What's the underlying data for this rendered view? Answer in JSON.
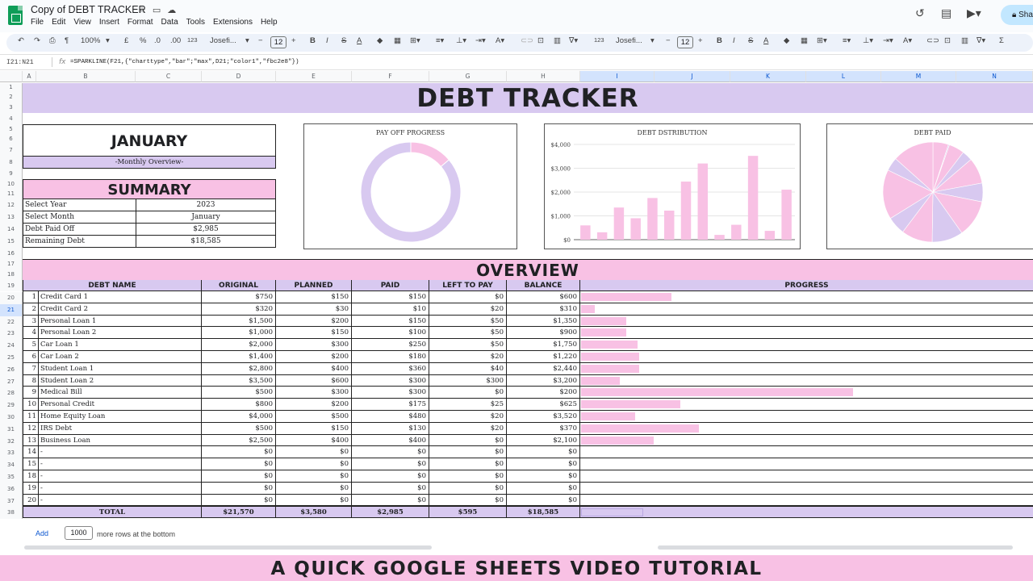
{
  "app": {
    "doc_title": "Copy of DEBT TRACKER",
    "menu": [
      "File",
      "Edit",
      "View",
      "Insert",
      "Format",
      "Data",
      "Tools",
      "Extensions",
      "Help"
    ],
    "share_label": "Sha",
    "colors": {
      "lavender": "#d8c9f0",
      "pink": "#f8c1e4",
      "accent_blue": "#d3e3fd",
      "sheets_green": "#0f9d58"
    }
  },
  "toolbar": {
    "zoom": "100%",
    "currency": "£",
    "percent": "%",
    "dec_less": ".0",
    "dec_more": ".00",
    "format_123": "123",
    "font": "Josefi...",
    "font_size": "12",
    "font2": "Josefi...",
    "font_size2": "12"
  },
  "formula_bar": {
    "name_box": "I21:N21",
    "fx": "fx",
    "formula": "=SPARKLINE(F21,{\"charttype\",\"bar\";\"max\",D21;\"color1\",\"fbc2e8\"})"
  },
  "columns": [
    "A",
    "B",
    "C",
    "D",
    "E",
    "F",
    "G",
    "H",
    "I",
    "J",
    "K",
    "L",
    "M",
    "N"
  ],
  "rows": [
    "1",
    "2",
    "3",
    "4",
    "5",
    "6",
    "7",
    "8",
    "9",
    "10",
    "11",
    "12",
    "13",
    "14",
    "15",
    "16",
    "17",
    "18",
    "19",
    "20",
    "21",
    "22",
    "23",
    "24",
    "25",
    "26",
    "27",
    "28",
    "29",
    "30",
    "31",
    "32",
    "33",
    "34",
    "35",
    "36",
    "37",
    "38"
  ],
  "sheet": {
    "banner": "DEBT TRACKER",
    "month_title": "JANUARY",
    "monthly_overview": "-Monthly Overview-",
    "summary_title": "SUMMARY",
    "summary": [
      {
        "label": "Select Year",
        "value": "2023"
      },
      {
        "label": "Select Month",
        "value": "January"
      },
      {
        "label": "Debt Paid Off",
        "value": "$2,985"
      },
      {
        "label": "Remaining Debt",
        "value": "$18,585"
      }
    ],
    "overview_title": "OVERVIEW",
    "headers": {
      "name": "DEBT NAME",
      "original": "ORIGINAL",
      "planned": "PLANNED",
      "paid": "PAID",
      "left": "LEFT TO PAY",
      "balance": "BALANCE",
      "progress": "PROGRESS"
    },
    "debts": [
      {
        "n": "1",
        "name": "Credit Card 1",
        "original": "$750",
        "planned": "$150",
        "paid": "$150",
        "left": "$0",
        "balance": "$600",
        "progress": 0.2
      },
      {
        "n": "2",
        "name": "Credit Card 2",
        "original": "$320",
        "planned": "$30",
        "paid": "$10",
        "left": "$20",
        "balance": "$310",
        "progress": 0.031
      },
      {
        "n": "3",
        "name": "Personal Loan 1",
        "original": "$1,500",
        "planned": "$200",
        "paid": "$150",
        "left": "$50",
        "balance": "$1,350",
        "progress": 0.1
      },
      {
        "n": "4",
        "name": "Personal Loan 2",
        "original": "$1,000",
        "planned": "$150",
        "paid": "$100",
        "left": "$50",
        "balance": "$900",
        "progress": 0.1
      },
      {
        "n": "5",
        "name": "Car Loan 1",
        "original": "$2,000",
        "planned": "$300",
        "paid": "$250",
        "left": "$50",
        "balance": "$1,750",
        "progress": 0.125
      },
      {
        "n": "6",
        "name": "Car Loan 2",
        "original": "$1,400",
        "planned": "$200",
        "paid": "$180",
        "left": "$20",
        "balance": "$1,220",
        "progress": 0.129
      },
      {
        "n": "7",
        "name": "Student Loan 1",
        "original": "$2,800",
        "planned": "$400",
        "paid": "$360",
        "left": "$40",
        "balance": "$2,440",
        "progress": 0.129
      },
      {
        "n": "8",
        "name": "Student Loan 2",
        "original": "$3,500",
        "planned": "$600",
        "paid": "$300",
        "left": "$300",
        "balance": "$3,200",
        "progress": 0.086
      },
      {
        "n": "9",
        "name": "Medical Bill",
        "original": "$500",
        "planned": "$300",
        "paid": "$300",
        "left": "$0",
        "balance": "$200",
        "progress": 0.6
      },
      {
        "n": "10",
        "name": "Personal Credit",
        "original": "$800",
        "planned": "$200",
        "paid": "$175",
        "left": "$25",
        "balance": "$625",
        "progress": 0.219
      },
      {
        "n": "11",
        "name": "Home Equity Loan",
        "original": "$4,000",
        "planned": "$500",
        "paid": "$480",
        "left": "$20",
        "balance": "$3,520",
        "progress": 0.12
      },
      {
        "n": "12",
        "name": "IRS Debt",
        "original": "$500",
        "planned": "$150",
        "paid": "$130",
        "left": "$20",
        "balance": "$370",
        "progress": 0.26
      },
      {
        "n": "13",
        "name": "Business Loan",
        "original": "$2,500",
        "planned": "$400",
        "paid": "$400",
        "left": "$0",
        "balance": "$2,100",
        "progress": 0.16
      },
      {
        "n": "14",
        "name": "-",
        "original": "$0",
        "planned": "$0",
        "paid": "$0",
        "left": "$0",
        "balance": "$0",
        "progress": 0
      },
      {
        "n": "15",
        "name": "-",
        "original": "$0",
        "planned": "$0",
        "paid": "$0",
        "left": "$0",
        "balance": "$0",
        "progress": 0
      },
      {
        "n": "18",
        "name": "-",
        "original": "$0",
        "planned": "$0",
        "paid": "$0",
        "left": "$0",
        "balance": "$0",
        "progress": 0
      },
      {
        "n": "19",
        "name": "-",
        "original": "$0",
        "planned": "$0",
        "paid": "$0",
        "left": "$0",
        "balance": "$0",
        "progress": 0
      },
      {
        "n": "20",
        "name": "-",
        "original": "$0",
        "planned": "$0",
        "paid": "$0",
        "left": "$0",
        "balance": "$0",
        "progress": 0
      }
    ],
    "total": {
      "label": "TOTAL",
      "original": "$21,570",
      "planned": "$3,580",
      "paid": "$2,985",
      "left": "$595",
      "balance": "$18,585",
      "progress": 0.138
    },
    "add_rows": {
      "label": "Add",
      "count": "1000",
      "suffix": "more rows at the bottom"
    }
  },
  "chart_data": [
    {
      "type": "pie",
      "title": "PAY OFF PROGRESS",
      "categories": [
        "Paid",
        "Remaining"
      ],
      "values": [
        2985,
        18585
      ],
      "colors": [
        "#f8c1e4",
        "#d8c9f0"
      ]
    },
    {
      "type": "bar",
      "title": "DEBT DSTRIBUTION",
      "categories": [
        "1",
        "2",
        "3",
        "4",
        "5",
        "6",
        "7",
        "8",
        "9",
        "10",
        "11",
        "12",
        "13"
      ],
      "values": [
        600,
        310,
        1350,
        900,
        1750,
        1220,
        2440,
        3200,
        200,
        625,
        3520,
        370,
        2100
      ],
      "ylim": [
        0,
        4000
      ],
      "y_ticks": [
        "$0",
        "$1,000",
        "$2,000",
        "$3,000",
        "$4,000"
      ],
      "grid": true
    },
    {
      "type": "pie",
      "title": "DEBT PAID",
      "categories": [
        "1",
        "2",
        "3",
        "4",
        "5",
        "6",
        "7",
        "8",
        "9",
        "10",
        "11",
        "12",
        "13"
      ],
      "values": [
        150,
        10,
        150,
        100,
        250,
        180,
        360,
        300,
        300,
        175,
        480,
        130,
        400
      ],
      "colors": [
        "#f8c1e4",
        "#d8c9f0"
      ]
    }
  ],
  "footer": "A QUICK GOOGLE SHEETS VIDEO TUTORIAL"
}
